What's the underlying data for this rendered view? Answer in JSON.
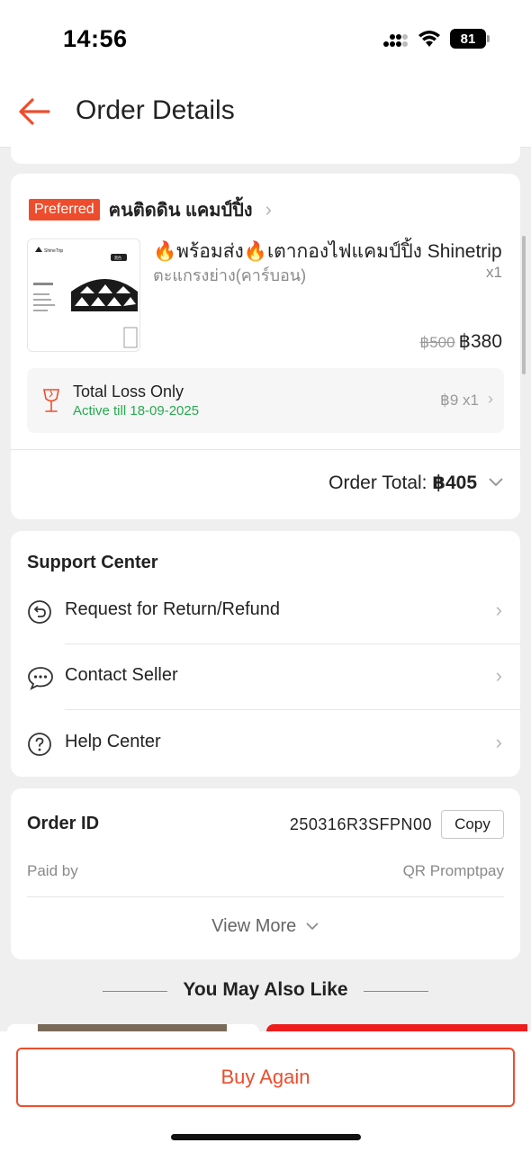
{
  "status_bar": {
    "time": "14:56",
    "battery": "81"
  },
  "header": {
    "title": "Order Details"
  },
  "shop": {
    "badge": "Preferred",
    "name": "ฅนติดดิน แคมป์ปิ้ง",
    "product": {
      "title": "🔥พร้อมส่ง🔥เตากองไฟแคมป์ปิ้ง Shinetrip",
      "variant": "ตะแกรงย่าง(คาร์บอน)",
      "quantity": "x1",
      "original_price": "฿500",
      "price": "฿380",
      "image_brand": "ShineTrip",
      "image_tag": "黑色"
    },
    "insurance": {
      "title": "Total Loss Only",
      "subtitle": "Active till 18-09-2025",
      "price": "฿9 x1"
    },
    "order_total_label": "Order Total: ",
    "order_total_value": "฿405"
  },
  "support": {
    "title": "Support Center",
    "items": [
      {
        "label": "Request for Return/Refund",
        "icon": "return-icon"
      },
      {
        "label": "Contact Seller",
        "icon": "chat-icon"
      },
      {
        "label": "Help Center",
        "icon": "help-icon"
      }
    ]
  },
  "order_info": {
    "id_label": "Order ID",
    "id_value": "250316R3SFPN00",
    "copy_label": "Copy",
    "paid_label": "Paid by",
    "paid_value": "QR Promptpay",
    "view_more": "View More"
  },
  "recommendations": {
    "title": "You May Also Like"
  },
  "footer": {
    "buy_again": "Buy Again"
  },
  "colors": {
    "accent": "#ee4d2d",
    "success": "#26aa4f",
    "background": "#efefef"
  }
}
